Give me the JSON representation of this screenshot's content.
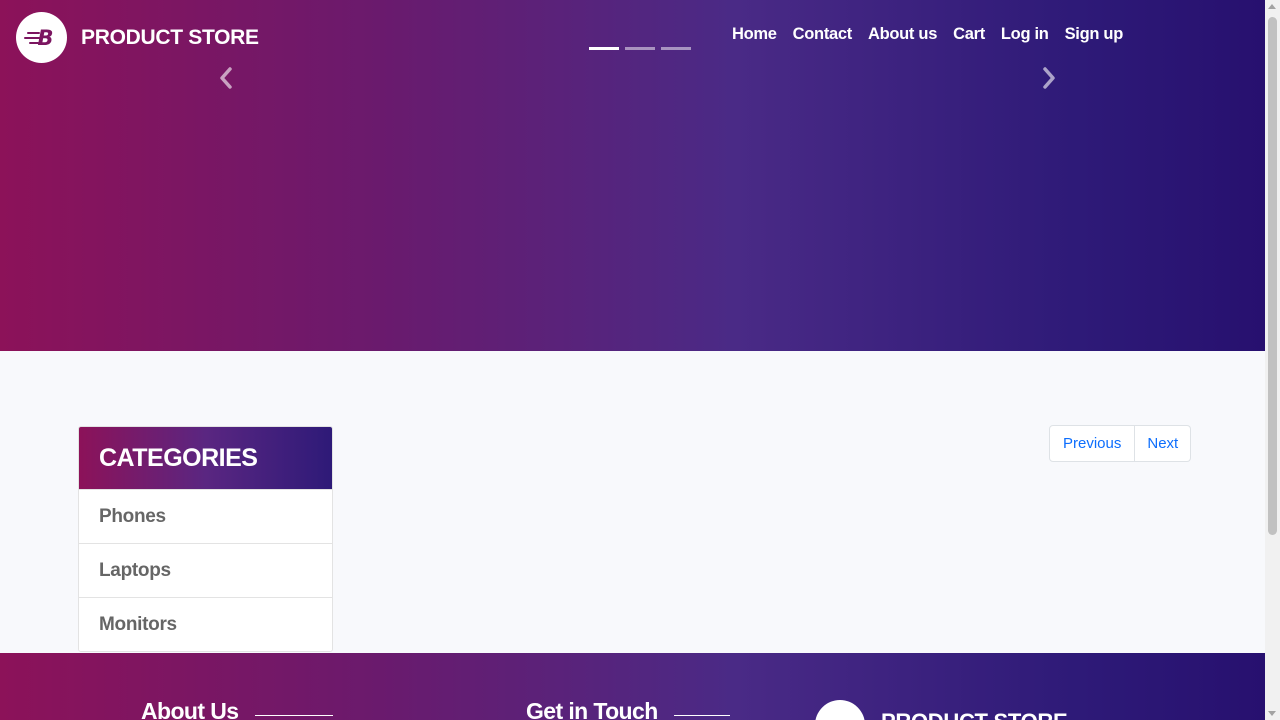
{
  "header": {
    "brand": "PRODUCT STORE",
    "logo_letter": "B",
    "nav": [
      "Home",
      "Contact",
      "About us",
      "Cart",
      "Log in",
      "Sign up"
    ]
  },
  "carousel": {
    "slide_count": 3,
    "active_slide": 1,
    "prev_icon": "chevron-left-icon",
    "next_icon": "chevron-right-icon"
  },
  "categories": {
    "title": "CATEGORIES",
    "items": [
      "Phones",
      "Laptops",
      "Monitors"
    ]
  },
  "pagination": {
    "previous": "Previous",
    "next": "Next"
  },
  "footer": {
    "about_heading": "About Us",
    "contact_heading": "Get in Touch",
    "brand": "PRODUCT STORE"
  },
  "colors": {
    "gradient_start": "#8c1259",
    "gradient_end": "#27106f",
    "link": "#0d6efd"
  }
}
